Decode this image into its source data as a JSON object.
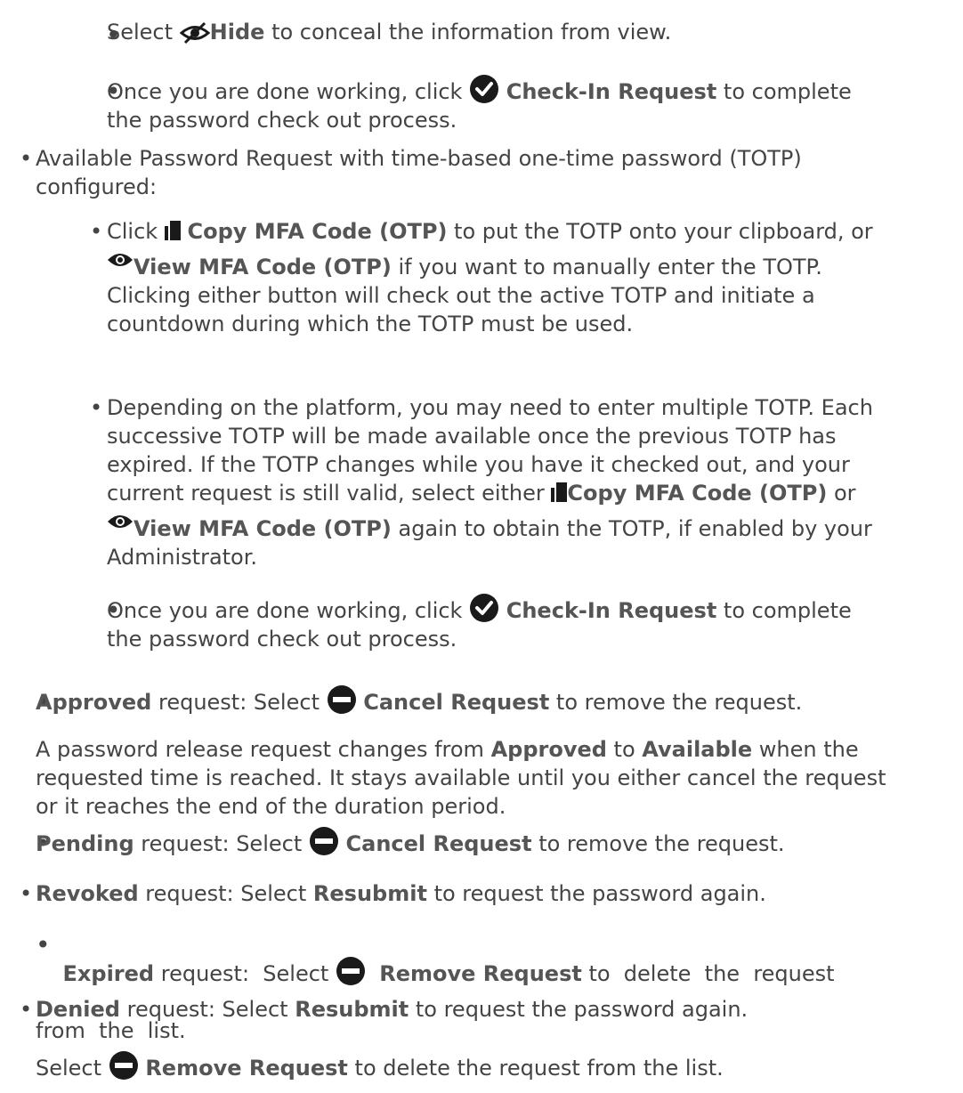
{
  "page": {
    "colors": {
      "text": "#444444",
      "bold_text": "#555555",
      "icon": "#1a1a1a"
    },
    "items": {
      "hide": {
        "icon": "eye-slash-icon",
        "pre": "Select ",
        "label": "Hide",
        "post": " to conceal the information from view."
      },
      "checkin_1": {
        "icon": "check-circle-icon",
        "pre": "Once you are done working, click ",
        "label": "Check-In Request",
        "post": " to complete",
        "line2": "the password check out process."
      },
      "totp_intro": {
        "line1": "Available Password Request with time-based one-time password (TOTP)",
        "line2": "configured:"
      },
      "copy_click": {
        "pre": "Click ",
        "copy_icon": "copy-icon",
        "copy_label": "Copy MFA Code (OTP)",
        "post": " to put the TOTP onto your clipboard, or",
        "view_icon": "eye-icon",
        "view_label": "View MFA Code (OTP)",
        "view_post": " if you want to manually enter the TOTP.",
        "line3": "Clicking either button will check out the active TOTP and initiate a",
        "line4": "countdown during which the TOTP must be used."
      },
      "depending": {
        "line1": "Depending on the platform, you may need to enter multiple TOTP. Each",
        "line2": "successive TOTP will be made available once the previous TOTP has",
        "line3": "expired. If the TOTP changes while you have it checked out, and your",
        "line4_pre": "current request is still valid, select either ",
        "copy_label": "Copy MFA Code (OTP)",
        "line4_post": " or",
        "view_label": "View MFA Code (OTP)",
        "line5_post": " again to obtain the TOTP, if enabled by your",
        "line6": "Administrator."
      },
      "checkin_2": {
        "pre": "Once you are done working, click ",
        "label": "Check-In Request",
        "post": " to complete",
        "line2": "the password check out process."
      },
      "approved": {
        "status": "Approved",
        "pre": " request: Select ",
        "icon": "minus-circle-icon",
        "label": "Cancel Request",
        "post": " to remove the request."
      },
      "approved_note": {
        "pre": "A password release request changes from ",
        "from": "Approved",
        "mid": " to ",
        "to": "Available",
        "post": " when the",
        "line2": "requested time is reached. It stays available until you either cancel the request",
        "line3": "or it reaches the end of the duration period."
      },
      "pending": {
        "status": "Pending",
        "pre": " request: Select ",
        "label": "Cancel Request",
        "post": " to remove the request."
      },
      "revoked": {
        "status": "Revoked",
        "pre": " request: Select ",
        "label": "Resubmit",
        "post": " to request the password again."
      },
      "expired": {
        "status": "Expired",
        "pre": " request:  Select ",
        "label": "Remove Request",
        "post": " to  delete  the  request",
        "line2": "from  the  list."
      },
      "denied": {
        "status": "Denied",
        "pre": " request: Select ",
        "label": "Resubmit",
        "post": " to request the password again."
      },
      "denied_remove": {
        "pre": "Select ",
        "label": "Remove Request",
        "post": " to delete the request from the list."
      }
    }
  }
}
